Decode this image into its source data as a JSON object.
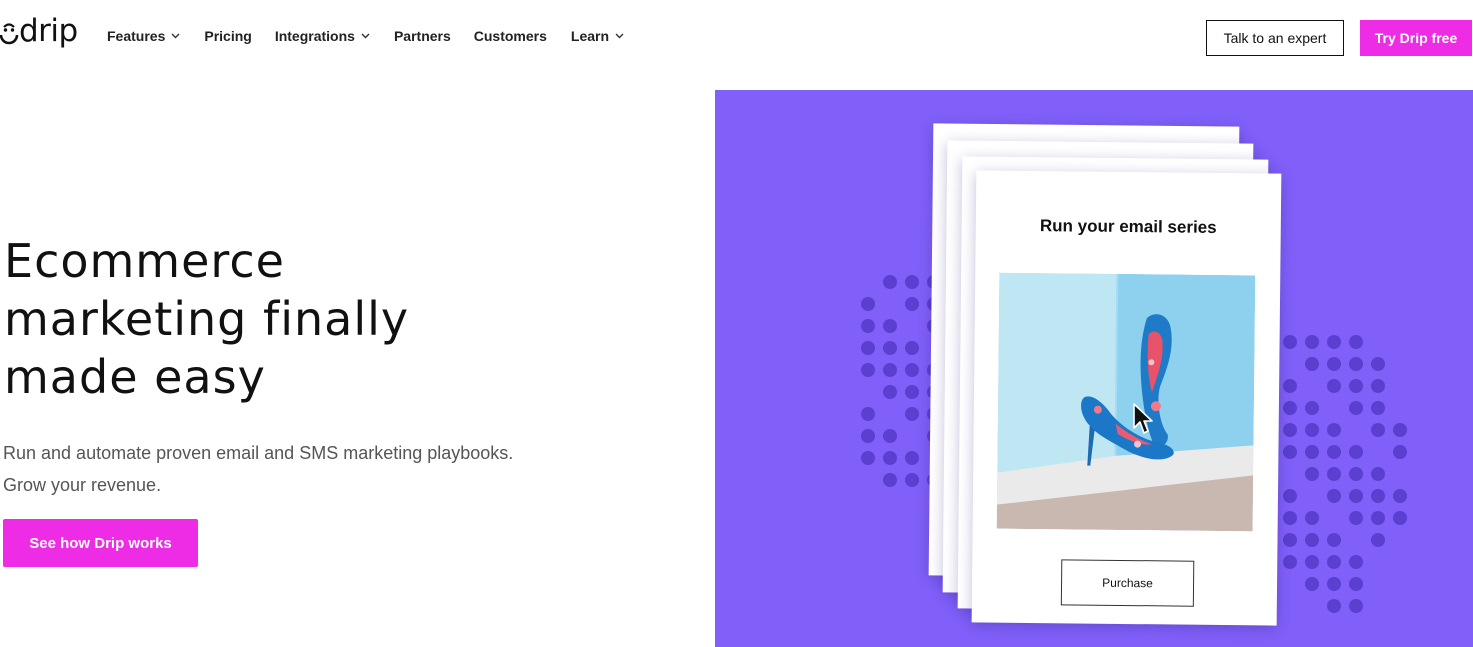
{
  "brand": {
    "logo_text": "drip",
    "accent_color": "#ee2be5",
    "hero_bg_color": "#8060f8"
  },
  "nav": {
    "items": [
      {
        "label": "Features",
        "has_dropdown": true
      },
      {
        "label": "Pricing",
        "has_dropdown": false
      },
      {
        "label": "Integrations",
        "has_dropdown": true
      },
      {
        "label": "Partners",
        "has_dropdown": false
      },
      {
        "label": "Customers",
        "has_dropdown": false
      },
      {
        "label": "Learn",
        "has_dropdown": true
      }
    ],
    "talk_label": "Talk to an expert",
    "try_label": "Try Drip free"
  },
  "hero": {
    "title_line1": "Ecommerce",
    "title_line2": "marketing finally",
    "title_line3": "made easy",
    "subtitle_line1": "Run and automate proven email and SMS marketing playbooks.",
    "subtitle_line2": "Grow your revenue.",
    "cta_label": "See how Drip works"
  },
  "email_card": {
    "title": "Run your email series",
    "image_icon": "high-heel-shoes-image",
    "button_label": "Purchase"
  },
  "icons": {
    "logo": "drip-logo-icon",
    "dropdown": "chevron-down-icon",
    "pointer": "mouse-pointer-icon"
  }
}
